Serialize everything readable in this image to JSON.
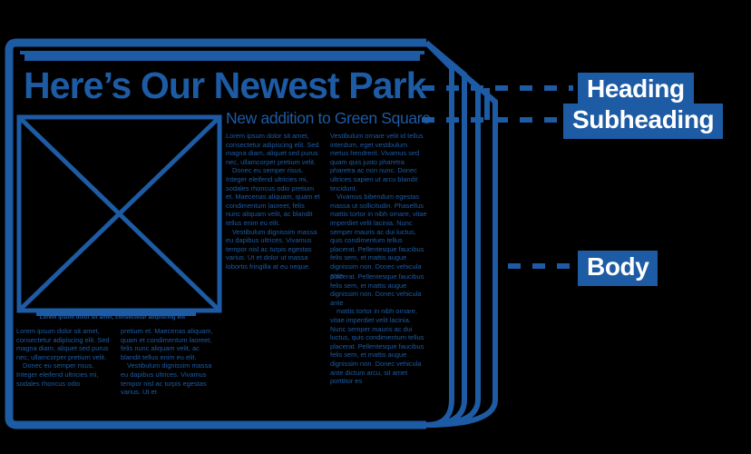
{
  "colors": {
    "line_blue": "#1d5ba4",
    "badge_blue": "#1d5ba4",
    "badge_text": "#ffffff",
    "background": "#000000"
  },
  "newspaper": {
    "headline": "Here’s Our Newest Park",
    "subheading": "New addition to Green Square",
    "image_caption": "Lorem ipsum dolor sit amet, consectetur adipiscing elit",
    "columns": {
      "upper_left": [
        "Lorem ipsum dolor sit amet, consectetur adipiscing elit. Sed magna diam, aliquet sed purus nec, ullamcorper pretium velit.",
        "Donec eu semper risus. Integer eleifend ultricies mi, sodales rhoncus odio pretium et. Maecenas aliquam, quam et condimentum laoreet, felis nunc aliquam velit, ac blandit tellus enim eu elit.",
        "Vestibulum dignissim massa eu dapibus ultrices. Vivamus tempor nisl ac turpis egestas varius. Ut et dolor ut massa lobortis fringilla at eu neque."
      ],
      "upper_right": [
        "Vestibulum ornare velit id tellus interdum, eget vestibulum metus hendrerit. Vivamus sed quam quis justo pharetra pharetra ac non nunc. Donec ultrices sapien ut arcu blandit tincidunt.",
        "Vivamus bibendum egestas massa ut sollicitudin. Phasellus mattis tortor in nibh ornare, vitae imperdiet velit lacinia. Nunc semper mauris ac dui luctus, quis condimentum tellus placerat. Pellentesque faucibus felis sem, et mattis augue dignissim non. Donec vehicula ante"
      ],
      "lower_left": [
        "Lorem ipsum dolor sit amet, consectetur adipiscing elit. Sed magna diam, aliquet sed purus nec, ullamcorper pretium velit.",
        "Donec eu semper risus. Integer eleifend ultricies mi, sodales rhoncus odio"
      ],
      "lower_middle": [
        "pretium et. Maecenas aliquam, quam et condimentum laoreet, felis nunc aliquam velit, ac blandit tellus enim eu elit.",
        "Vestibulum dignissim massa eu dapibus ultrices. Vivamus tempor nisl ac turpis egestas varius. Ut et"
      ],
      "lower_right": [
        "placerat. Pellentesque faucibus felis sem, et mattis augue dignissim non. Donec vehicula ante",
        "mattis tortor in nibh ornare, vitae imperdiet velit lacinia. Nunc semper mauris ac dui luctus, quis condimentum tellus placerat. Pellentesque faucibus felis sem, et mattis augue dignissim non. Donec vehicula ante dictum arcu, sit amet porttitor es"
      ]
    }
  },
  "annotations": {
    "heading": "Heading",
    "subheading": "Subheading",
    "body": "Body"
  }
}
